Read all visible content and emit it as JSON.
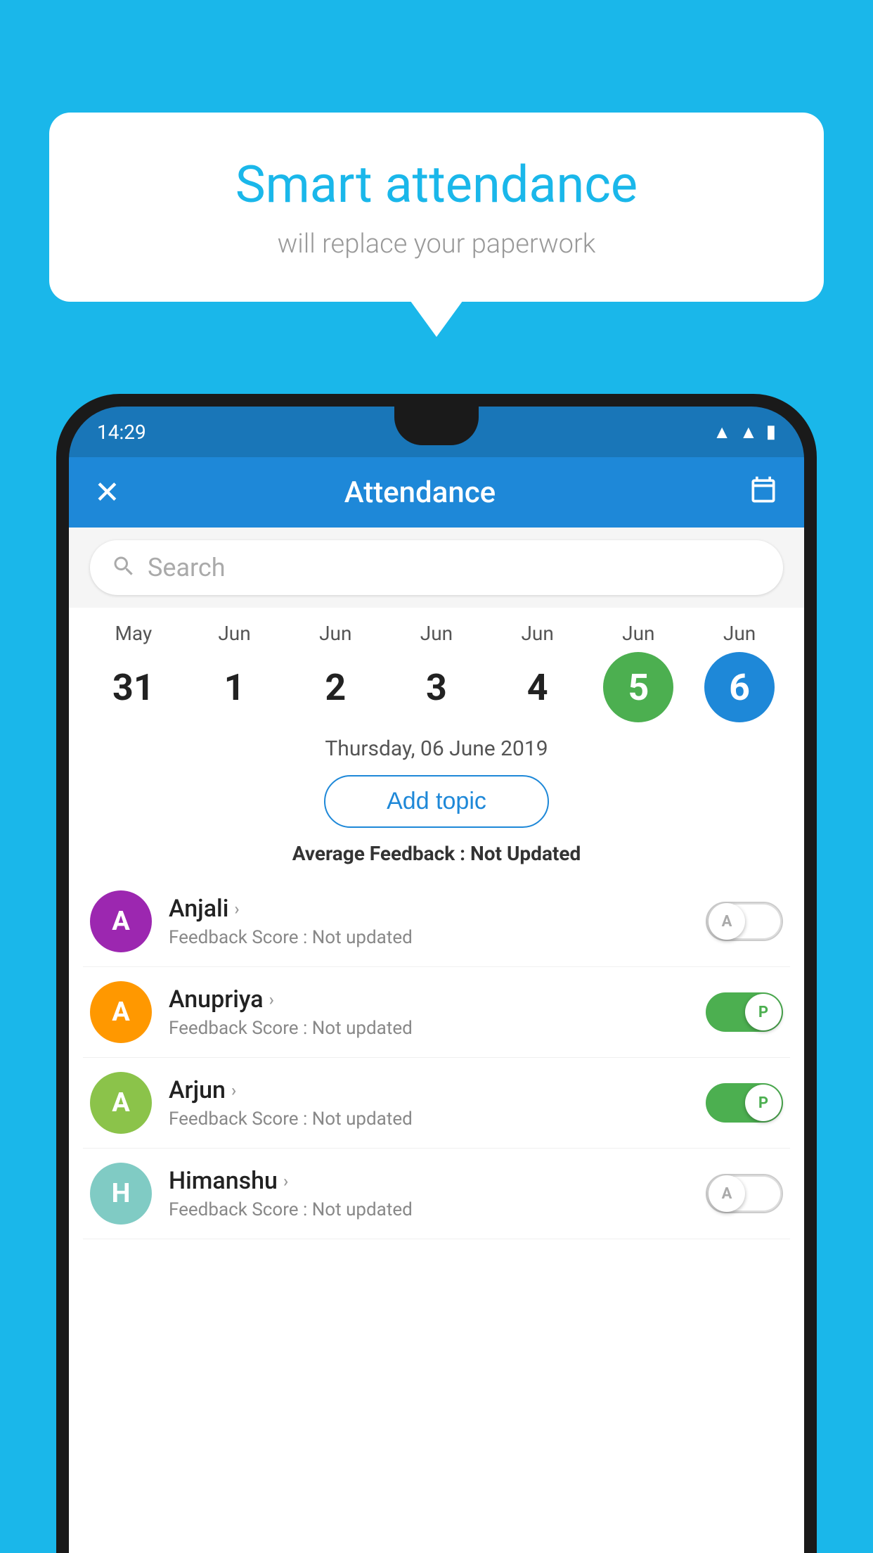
{
  "background_color": "#1ab7ea",
  "bubble": {
    "title": "Smart attendance",
    "subtitle": "will replace your paperwork"
  },
  "app_bar": {
    "title": "Attendance",
    "close_label": "×",
    "calendar_icon": "calendar-icon"
  },
  "status_bar": {
    "time": "14:29"
  },
  "search": {
    "placeholder": "Search"
  },
  "calendar": {
    "days": [
      {
        "month": "May",
        "date": "31",
        "selected": false
      },
      {
        "month": "Jun",
        "date": "1",
        "selected": false
      },
      {
        "month": "Jun",
        "date": "2",
        "selected": false
      },
      {
        "month": "Jun",
        "date": "3",
        "selected": false
      },
      {
        "month": "Jun",
        "date": "4",
        "selected": false
      },
      {
        "month": "Jun",
        "date": "5",
        "selected": "green"
      },
      {
        "month": "Jun",
        "date": "6",
        "selected": "blue"
      }
    ],
    "selected_date_label": "Thursday, 06 June 2019"
  },
  "add_topic_label": "Add topic",
  "avg_feedback": {
    "label": "Average Feedback : ",
    "value": "Not Updated"
  },
  "students": [
    {
      "name": "Anjali",
      "avatar_letter": "A",
      "avatar_color": "purple",
      "feedback": "Feedback Score : Not updated",
      "toggle_state": "off",
      "toggle_label": "A"
    },
    {
      "name": "Anupriya",
      "avatar_letter": "A",
      "avatar_color": "orange",
      "feedback": "Feedback Score : Not updated",
      "toggle_state": "on",
      "toggle_label": "P"
    },
    {
      "name": "Arjun",
      "avatar_letter": "A",
      "avatar_color": "green",
      "feedback": "Feedback Score : Not updated",
      "toggle_state": "on",
      "toggle_label": "P"
    },
    {
      "name": "Himanshu",
      "avatar_letter": "H",
      "avatar_color": "teal",
      "feedback": "Feedback Score : Not updated",
      "toggle_state": "off",
      "toggle_label": "A"
    }
  ]
}
